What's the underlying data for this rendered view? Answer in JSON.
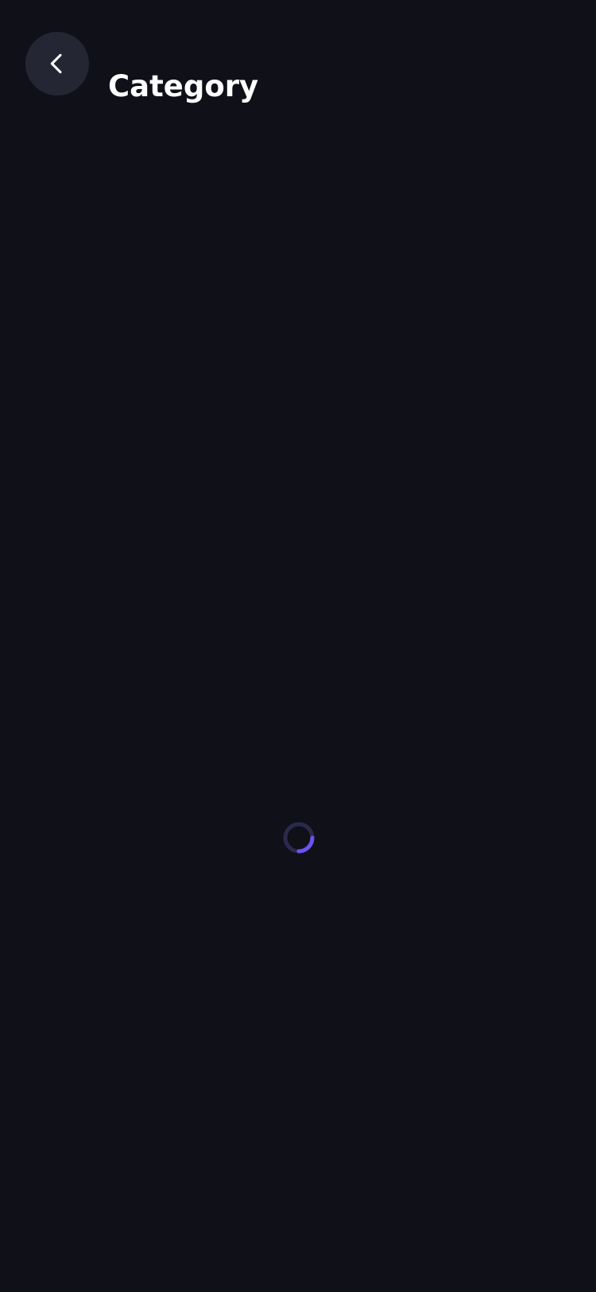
{
  "header": {
    "title": "Category",
    "back_icon": "chevron-left-icon"
  },
  "loading": {
    "indicator_icon": "loading-spinner-icon",
    "progress": 0.25
  },
  "colors": {
    "background": "#0f1018",
    "back_button_bg": "#252633",
    "title_text": "#ffffff",
    "spinner_track": "#2b2a4d",
    "spinner_accent": "#6a54f0"
  }
}
